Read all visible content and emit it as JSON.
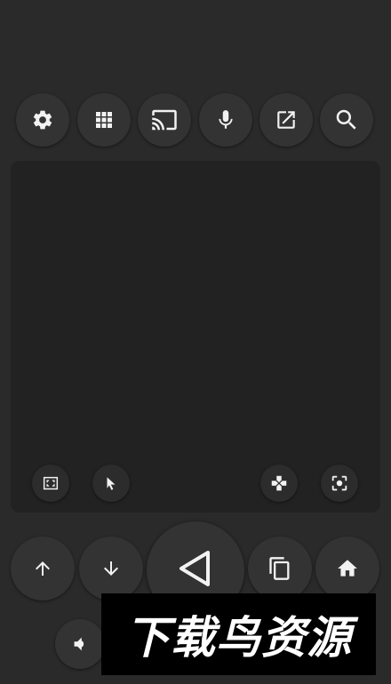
{
  "toolbar": {
    "buttons": [
      {
        "name": "settings",
        "icon": "gear-icon"
      },
      {
        "name": "apps",
        "icon": "grid-icon"
      },
      {
        "name": "cast",
        "icon": "cast-icon"
      },
      {
        "name": "voice",
        "icon": "microphone-icon"
      },
      {
        "name": "open-external",
        "icon": "external-link-icon"
      },
      {
        "name": "search",
        "icon": "search-icon"
      }
    ]
  },
  "trackpad": {
    "controls": [
      {
        "name": "fullscreen",
        "icon": "fullscreen-icon"
      },
      {
        "name": "pointer-mode",
        "icon": "cursor-icon"
      },
      {
        "name": "gamepad-mode",
        "icon": "dpad-icon"
      },
      {
        "name": "screenshot",
        "icon": "focus-capture-icon"
      }
    ]
  },
  "navigation": {
    "buttons": [
      {
        "name": "up",
        "icon": "arrow-up-icon"
      },
      {
        "name": "down",
        "icon": "arrow-down-icon"
      },
      {
        "name": "back",
        "icon": "back-triangle-icon"
      },
      {
        "name": "recents",
        "icon": "copy-icon"
      },
      {
        "name": "home",
        "icon": "home-icon"
      },
      {
        "name": "volume",
        "icon": "volume-icon"
      }
    ]
  },
  "watermark": {
    "text": "下载鸟资源"
  },
  "colors": {
    "background": "#2a2a2a",
    "button": "#333333",
    "trackpad": "#222222",
    "icon": "#f2f2f2"
  }
}
